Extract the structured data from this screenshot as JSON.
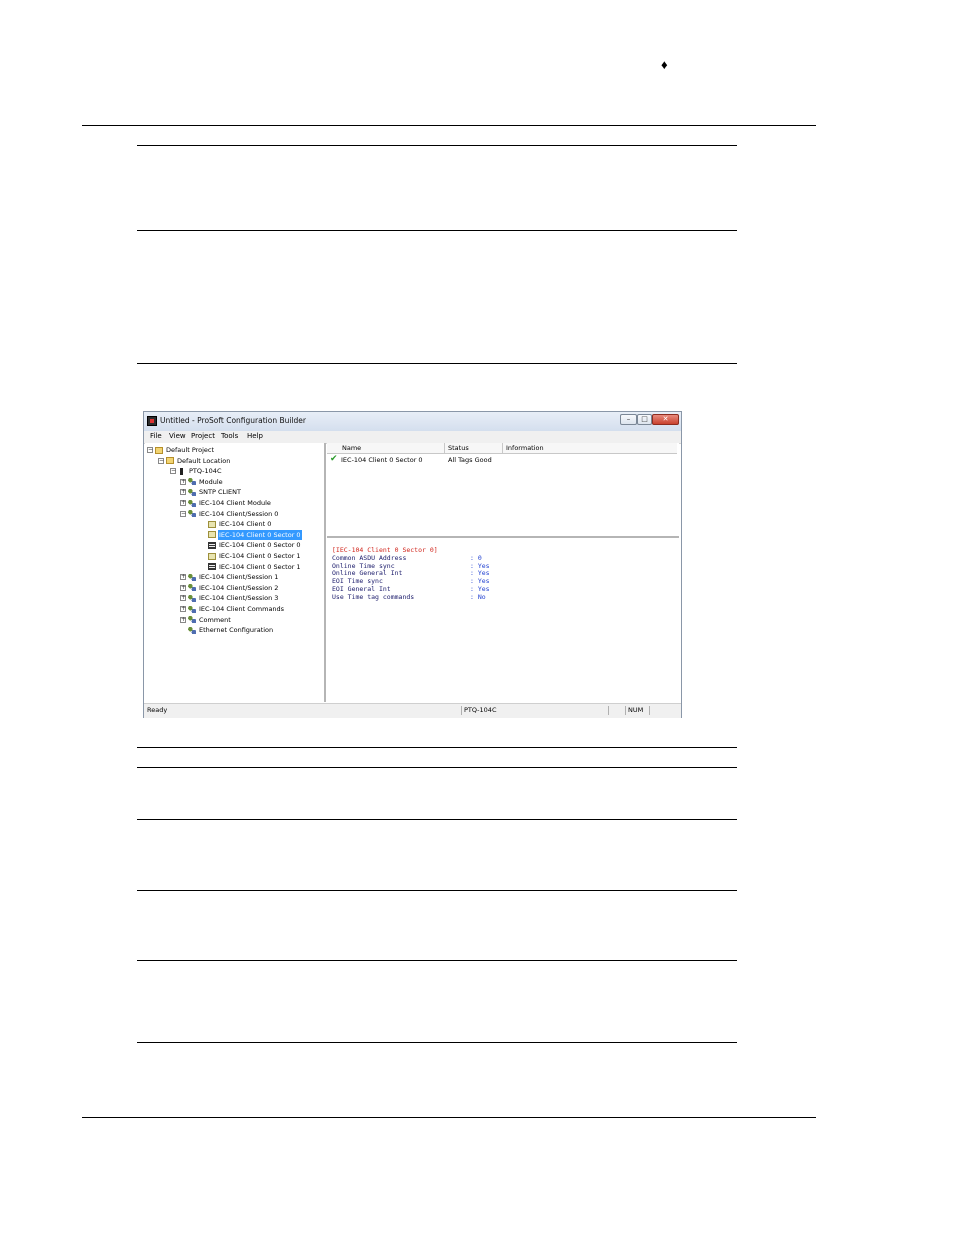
{
  "header": {
    "diamond": "♦"
  },
  "window": {
    "title": "Untitled - ProSoft Configuration Builder",
    "menu": [
      "File",
      "View",
      "Project",
      "Tools",
      "Help"
    ],
    "tree": [
      {
        "label": "Default Project",
        "icon": "folder-icon",
        "expander": "−"
      },
      {
        "label": "Default Location",
        "icon": "folder-icon",
        "expander": "−"
      },
      {
        "label": "PTQ-104C",
        "icon": "module-icon",
        "expander": "−"
      },
      {
        "label": "Module",
        "icon": "network-icon",
        "expander": "+"
      },
      {
        "label": "SNTP CLIENT",
        "icon": "network-icon",
        "expander": "+"
      },
      {
        "label": "IEC-104 Client Module",
        "icon": "network-icon",
        "expander": "+"
      },
      {
        "label": "IEC-104 Client/Session 0",
        "icon": "network-icon",
        "expander": "−"
      },
      {
        "label": "IEC-104 Client 0",
        "icon": "document-icon",
        "expander": ""
      },
      {
        "label": "IEC-104 Client 0 Sector 0",
        "icon": "document-icon",
        "expander": "",
        "selected": true
      },
      {
        "label": "IEC-104 Client 0 Sector 0",
        "icon": "grid-icon",
        "expander": ""
      },
      {
        "label": "IEC-104 Client 0 Sector 1",
        "icon": "document-icon",
        "expander": ""
      },
      {
        "label": "IEC-104 Client 0 Sector 1",
        "icon": "grid-icon",
        "expander": ""
      },
      {
        "label": "IEC-104 Client/Session 1",
        "icon": "network-icon",
        "expander": "+"
      },
      {
        "label": "IEC-104 Client/Session 2",
        "icon": "network-icon",
        "expander": "+"
      },
      {
        "label": "IEC-104 Client/Session 3",
        "icon": "network-icon",
        "expander": "+"
      },
      {
        "label": "IEC-104 Client Commands",
        "icon": "network-icon",
        "expander": "+"
      },
      {
        "label": "Comment",
        "icon": "network-icon",
        "expander": "+"
      },
      {
        "label": "Ethernet Configuration",
        "icon": "network-icon",
        "expander": ""
      }
    ],
    "list": {
      "columns": [
        "Name",
        "Status",
        "Information"
      ],
      "rows": [
        {
          "name": "IEC-104 Client 0 Sector 0",
          "status": "All Tags Good",
          "information": ""
        }
      ]
    },
    "detail": {
      "title": "[IEC-104 Client 0 Sector 0]",
      "rows": [
        {
          "key": "Common ASDU Address",
          "value": ": 0"
        },
        {
          "key": "Online Time sync",
          "value": ": Yes"
        },
        {
          "key": "Online General Int",
          "value": ": Yes"
        },
        {
          "key": "EOI Time sync",
          "value": ": Yes"
        },
        {
          "key": "EOI General Int",
          "value": ": Yes"
        },
        {
          "key": "Use Time tag commands",
          "value": ": No"
        }
      ]
    },
    "status": {
      "ready": "Ready",
      "module": "PTQ-104C",
      "num": "NUM"
    }
  }
}
